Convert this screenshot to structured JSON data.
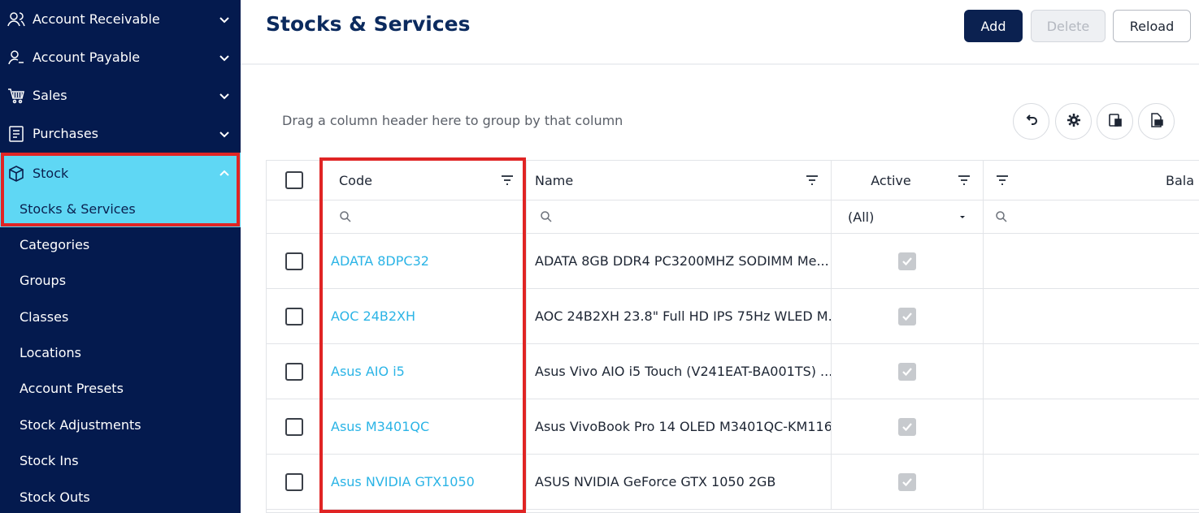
{
  "sidebar": {
    "items": [
      {
        "label": "Account Receivable",
        "icon": "users-icon"
      },
      {
        "label": "Account Payable",
        "icon": "user-minus-icon"
      },
      {
        "label": "Sales",
        "icon": "cart-icon"
      },
      {
        "label": "Purchases",
        "icon": "receipt-icon"
      },
      {
        "label": "Stock",
        "icon": "box-icon"
      }
    ],
    "stock_subitems": [
      "Stocks & Services",
      "Categories",
      "Groups",
      "Classes",
      "Locations",
      "Account Presets",
      "Stock Adjustments",
      "Stock Ins",
      "Stock Outs"
    ]
  },
  "header": {
    "title": "Stocks & Services",
    "add_label": "Add",
    "delete_label": "Delete",
    "reload_label": "Reload"
  },
  "grid": {
    "group_hint": "Drag a column header here to group by that column",
    "columns": {
      "code": "Code",
      "name": "Name",
      "active": "Active",
      "balance": "Bala"
    },
    "active_filter": "(All)",
    "rows": [
      {
        "code": "ADATA 8DPC32",
        "name": "ADATA 8GB DDR4 PC3200MHZ SODIMM Me...",
        "active": true
      },
      {
        "code": "AOC 24B2XH",
        "name": "AOC 24B2XH 23.8\" Full HD IPS 75Hz WLED M...",
        "active": true
      },
      {
        "code": "Asus AIO i5",
        "name": "Asus Vivo AIO i5 Touch (V241EAT-BA001TS) ...",
        "active": true
      },
      {
        "code": "Asus M3401QC",
        "name": "Asus VivoBook Pro 14 OLED M3401QC-KM116...",
        "active": true
      },
      {
        "code": "Asus NVIDIA GTX1050",
        "name": "ASUS NVIDIA GeForce GTX 1050 2GB",
        "active": true
      }
    ]
  },
  "colors": {
    "sidebar_bg": "#041a4e",
    "active_bg": "#5fd7f4",
    "highlight": "#e02424",
    "link": "#2bb4e6",
    "primary": "#0b2150"
  }
}
